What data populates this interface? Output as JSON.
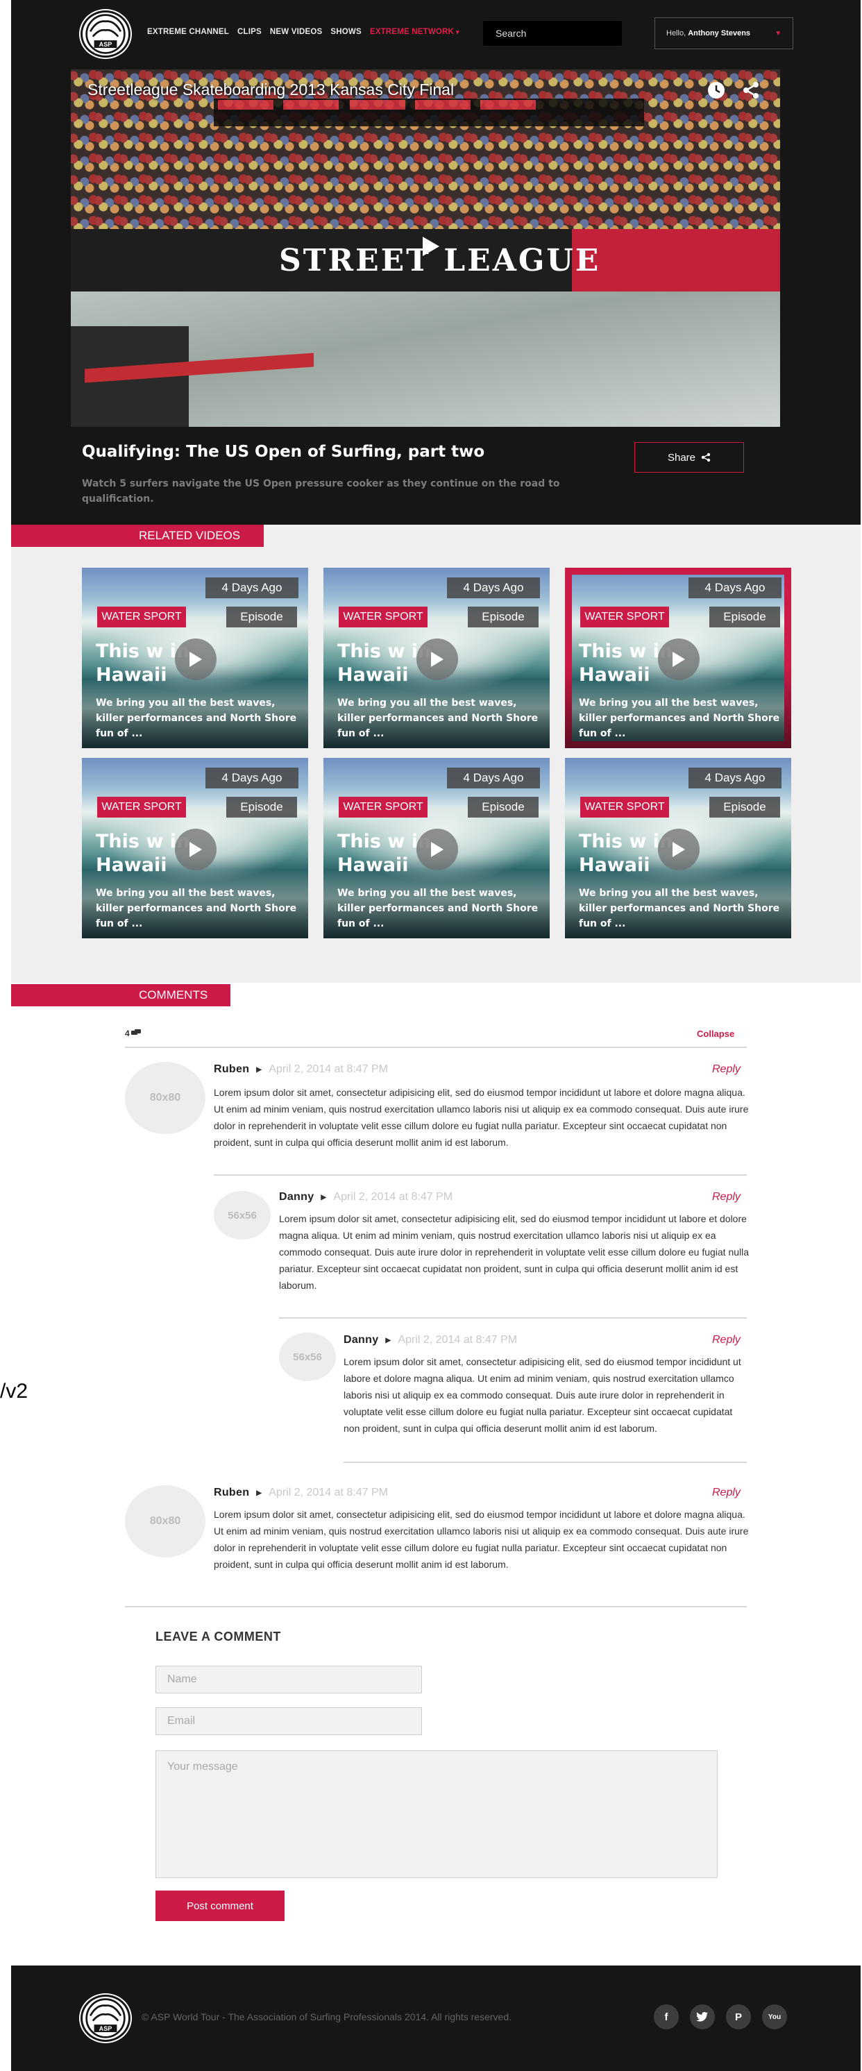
{
  "stray_text": "/v2",
  "header": {
    "nav": [
      {
        "label": "EXTREME CHANNEL"
      },
      {
        "label": "CLIPS"
      },
      {
        "label": "NEW VIDEOS"
      },
      {
        "label": "SHOWS"
      },
      {
        "label": "EXTREME NETWORK"
      }
    ],
    "search_placeholder": "Search",
    "greeting": "Hello,",
    "user_name": "Anthony Stevens"
  },
  "player": {
    "title": "Streetleague Skateboarding 2013 Kansas City Final",
    "banner_text": "STREET LEAGUE"
  },
  "video_info": {
    "headline": "Qualifying: The US Open of Surfing, part two",
    "description": "Watch 5 surfers navigate the US Open pressure cooker as they continue on the road to qualification.",
    "share_label": "Share"
  },
  "related": {
    "label": "RELATED VIDEOS",
    "cards": [
      {
        "age": "4 Days Ago",
        "category": "WATER SPORT",
        "type": "Episode",
        "title": "This w   in Hawaii",
        "desc": "We bring you all the best waves, killer performances and North Shore fun of ...",
        "active": false
      },
      {
        "age": "4 Days Ago",
        "category": "WATER SPORT",
        "type": "Episode",
        "title": "This w   in Hawaii",
        "desc": "We bring you all the best waves, killer performances and North Shore fun of ...",
        "active": false
      },
      {
        "age": "4 Days Ago",
        "category": "WATER SPORT",
        "type": "Episode",
        "title": "This w   in Hawaii",
        "desc": "We bring you all the best waves, killer performances and North Shore fun of ...",
        "active": true
      },
      {
        "age": "4 Days Ago",
        "category": "WATER SPORT",
        "type": "Episode",
        "title": "This w   in Hawaii",
        "desc": "We bring you all the best waves, killer performances and North Shore fun of ...",
        "active": false
      },
      {
        "age": "4 Days Ago",
        "category": "WATER SPORT",
        "type": "Episode",
        "title": "This w   in Hawaii",
        "desc": "We bring you all the best waves, killer performances and North Shore fun of ...",
        "active": false
      },
      {
        "age": "4 Days Ago",
        "category": "WATER SPORT",
        "type": "Episode",
        "title": "This w   in Hawaii",
        "desc": "We bring you all the best waves, killer performances and North Shore fun of ...",
        "active": false
      }
    ]
  },
  "comments": {
    "label": "COMMENTS",
    "count": "4",
    "collapse_label": "Collapse",
    "reply_label": "Reply",
    "items": [
      {
        "name": "Ruben",
        "date": "April 2, 2014 at 8:47 PM",
        "avatar": "80x80",
        "text": "Lorem ipsum dolor sit amet, consectetur adipisicing elit, sed do eiusmod tempor incididunt ut labore et dolore magna aliqua. Ut enim ad minim veniam, quis nostrud exercitation ullamco laboris nisi ut aliquip ex ea commodo consequat. Duis aute irure dolor in reprehenderit in voluptate velit esse cillum dolore eu fugiat nulla pariatur. Excepteur sint occaecat cupidatat non proident, sunt in culpa qui officia deserunt mollit anim id est laborum."
      },
      {
        "name": "Danny",
        "date": "April 2, 2014 at 8:47 PM",
        "avatar": "56x56",
        "text": "Lorem ipsum dolor sit amet, consectetur adipisicing elit, sed do eiusmod tempor incididunt ut labore et dolore magna aliqua. Ut enim ad minim veniam, quis nostrud exercitation ullamco laboris nisi ut aliquip ex ea commodo consequat. Duis aute irure dolor in reprehenderit in voluptate velit esse cillum dolore eu fugiat nulla pariatur. Excepteur sint occaecat cupidatat non proident, sunt in culpa qui officia deserunt mollit anim id est laborum."
      },
      {
        "name": "Danny",
        "date": "April 2, 2014 at 8:47 PM",
        "avatar": "56x56",
        "text": "Lorem ipsum dolor sit amet, consectetur adipisicing elit, sed do eiusmod tempor incididunt ut labore et dolore magna aliqua. Ut enim ad minim veniam, quis nostrud exercitation ullamco laboris nisi ut aliquip ex ea commodo consequat. Duis aute irure dolor in reprehenderit in voluptate velit esse cillum dolore eu fugiat nulla pariatur. Excepteur sint occaecat cupidatat non proident, sunt in culpa qui officia deserunt mollit anim id est laborum."
      },
      {
        "name": "Ruben",
        "date": "April 2, 2014 at 8:47 PM",
        "avatar": "80x80",
        "text": "Lorem ipsum dolor sit amet, consectetur adipisicing elit, sed do eiusmod tempor incididunt ut labore et dolore magna aliqua. Ut enim ad minim veniam, quis nostrud exercitation ullamco laboris nisi ut aliquip ex ea commodo consequat. Duis aute irure dolor in reprehenderit in voluptate velit esse cillum dolore eu fugiat nulla pariatur. Excepteur sint occaecat cupidatat non proident, sunt in culpa qui officia deserunt mollit anim id est laborum."
      }
    ]
  },
  "leave_comment": {
    "title": "LEAVE A COMMENT",
    "name_placeholder": "Name",
    "email_placeholder": "Email",
    "message_placeholder": "Your message",
    "submit_label": "Post comment"
  },
  "footer": {
    "copyright": "© ASP World Tour - The Association of Surfing Professionals 2014. All rights reserved.",
    "social": [
      "facebook-icon",
      "twitter-icon",
      "pinterest-icon",
      "youtube-icon"
    ]
  },
  "colors": {
    "accent": "#cd1b48",
    "dark_bg": "#161616",
    "light_bg": "#efefef"
  }
}
